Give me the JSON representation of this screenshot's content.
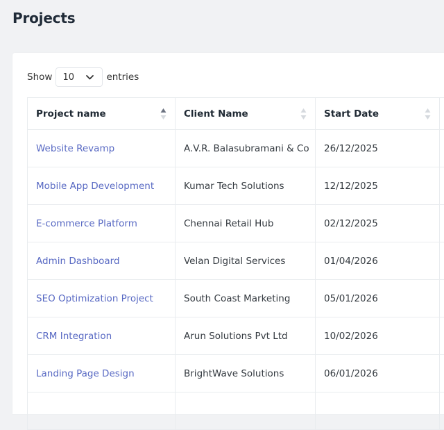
{
  "page": {
    "title": "Projects"
  },
  "length_menu": {
    "show_label": "Show",
    "selected": "10",
    "entries_label": "entries"
  },
  "table": {
    "headers": [
      {
        "label": "Project name",
        "sort": "ascending"
      },
      {
        "label": "Client Name",
        "sort": "none"
      },
      {
        "label": "Start Date",
        "sort": "none"
      },
      {
        "label": "",
        "sort": "none"
      }
    ],
    "rows": [
      {
        "project": "Website Revamp",
        "client": "A.V.R. Balasubramani & Co",
        "start_date": "26/12/2025"
      },
      {
        "project": "Mobile App Development",
        "client": "Kumar Tech Solutions",
        "start_date": "12/12/2025"
      },
      {
        "project": "E-commerce Platform",
        "client": "Chennai Retail Hub",
        "start_date": "02/12/2025"
      },
      {
        "project": "Admin Dashboard",
        "client": "Velan Digital Services",
        "start_date": "01/04/2026"
      },
      {
        "project": "SEO Optimization Project",
        "client": "South Coast Marketing",
        "start_date": "05/01/2026"
      },
      {
        "project": "CRM Integration",
        "client": "Arun Solutions Pvt Ltd",
        "start_date": "10/02/2026"
      },
      {
        "project": "Landing Page Design",
        "client": "BrightWave Solutions",
        "start_date": "06/01/2026"
      }
    ]
  },
  "colors": {
    "page_bg": "#f1f2f4",
    "card_bg": "#ffffff",
    "link": "#5869c3",
    "border": "#e9ecef"
  },
  "icons": {
    "sort": "sort-arrows-icon",
    "dropdown": "chevron-down-icon"
  }
}
